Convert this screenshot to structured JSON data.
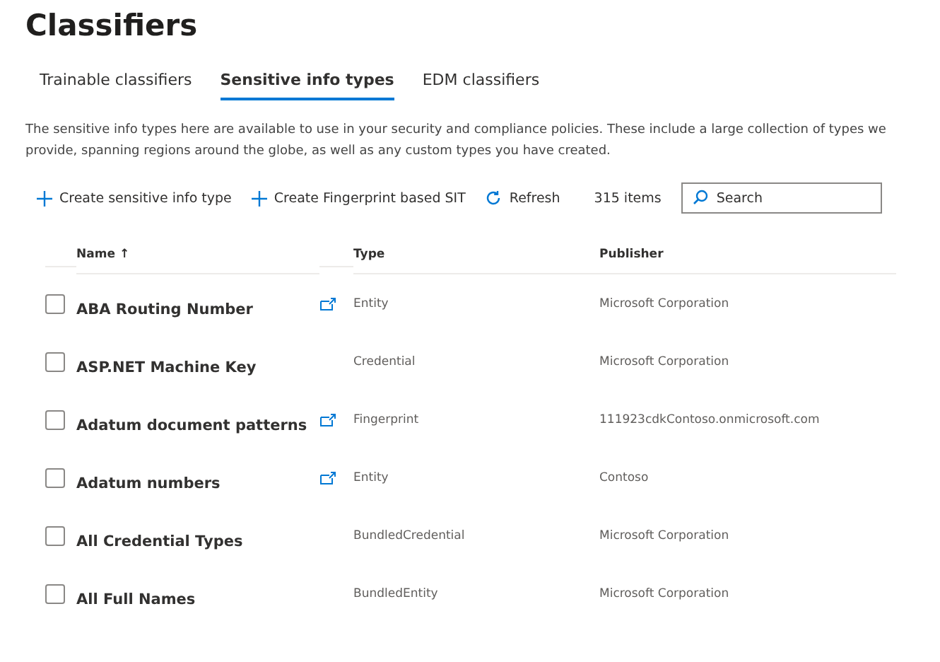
{
  "title": "Classifiers",
  "tabs": [
    {
      "label": "Trainable classifiers",
      "selected": false
    },
    {
      "label": "Sensitive info types",
      "selected": true
    },
    {
      "label": "EDM classifiers",
      "selected": false
    }
  ],
  "description": "The sensitive info types here are available to use in your security and compliance policies. These include a large collection of types we provide, spanning regions around the globe, as well as any custom types you have created.",
  "toolbar": {
    "actions": [
      {
        "label": "Create sensitive info type",
        "kind": "add"
      },
      {
        "label": "Create Fingerprint based SIT",
        "kind": "add"
      },
      {
        "label": "Refresh",
        "kind": "refresh"
      }
    ],
    "count": "315 items",
    "search": {
      "placeholder": "Search"
    }
  },
  "table": {
    "columns": [
      {
        "label": "Name",
        "sort": "↑"
      },
      {
        "label": "Type"
      },
      {
        "label": "Publisher"
      }
    ],
    "rows": [
      {
        "name": "ABA Routing Number",
        "editable": true,
        "type": "Entity",
        "publisher": "Microsoft Corporation",
        "checked": false
      },
      {
        "name": "ASP.NET Machine Key",
        "editable": false,
        "type": "Credential",
        "publisher": "Microsoft Corporation",
        "checked": false
      },
      {
        "name": "Adatum document patterns",
        "editable": true,
        "type": "Fingerprint",
        "publisher": "111923cdkContoso.onmicrosoft.com",
        "checked": false
      },
      {
        "name": "Adatum numbers",
        "editable": true,
        "type": "Entity",
        "publisher": "Contoso",
        "checked": false
      },
      {
        "name": "All Credential Types",
        "editable": false,
        "type": "BundledCredential",
        "publisher": "Microsoft Corporation",
        "checked": false
      },
      {
        "name": "All Full Names",
        "editable": false,
        "type": "BundledEntity",
        "publisher": "Microsoft Corporation",
        "checked": false
      }
    ]
  }
}
